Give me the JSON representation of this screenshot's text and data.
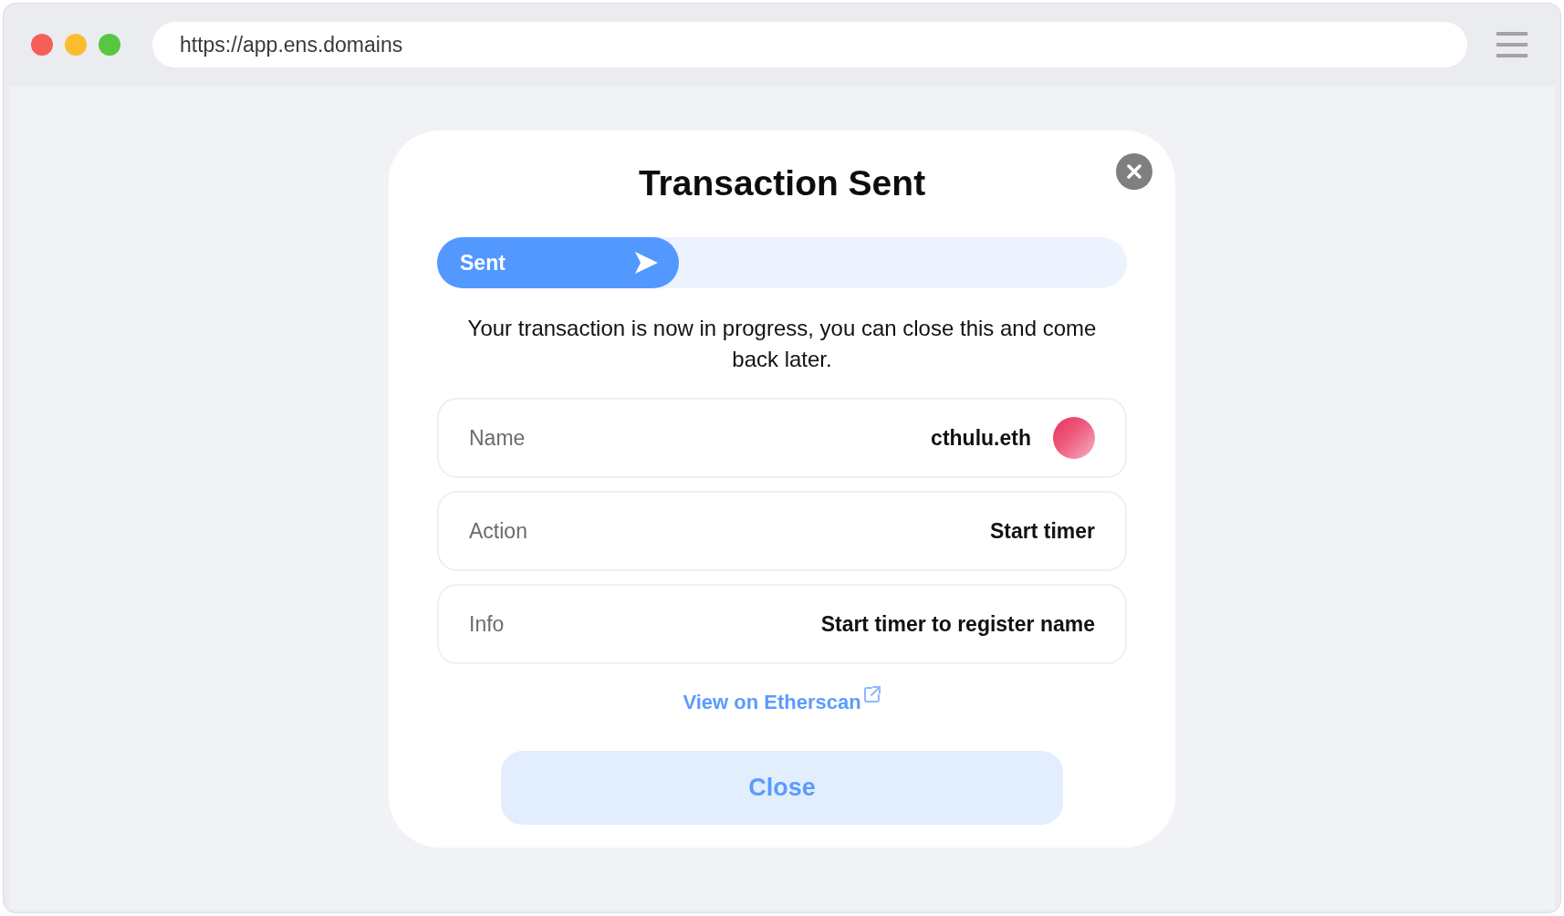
{
  "browser": {
    "url": "https://app.ens.domains"
  },
  "dialog": {
    "title": "Transaction Sent",
    "progress": {
      "label": "Sent",
      "level": 0.35
    },
    "message": "Your transaction is now in progress, you can close this and come back later.",
    "details": [
      {
        "kind": "name",
        "label": "Name",
        "value": "cthulu.eth"
      },
      {
        "kind": "text",
        "label": "Action",
        "value": "Start timer"
      },
      {
        "kind": "text",
        "label": "Info",
        "value": "Start timer to register name"
      }
    ],
    "link": "View on Etherscan",
    "button": "Close"
  }
}
